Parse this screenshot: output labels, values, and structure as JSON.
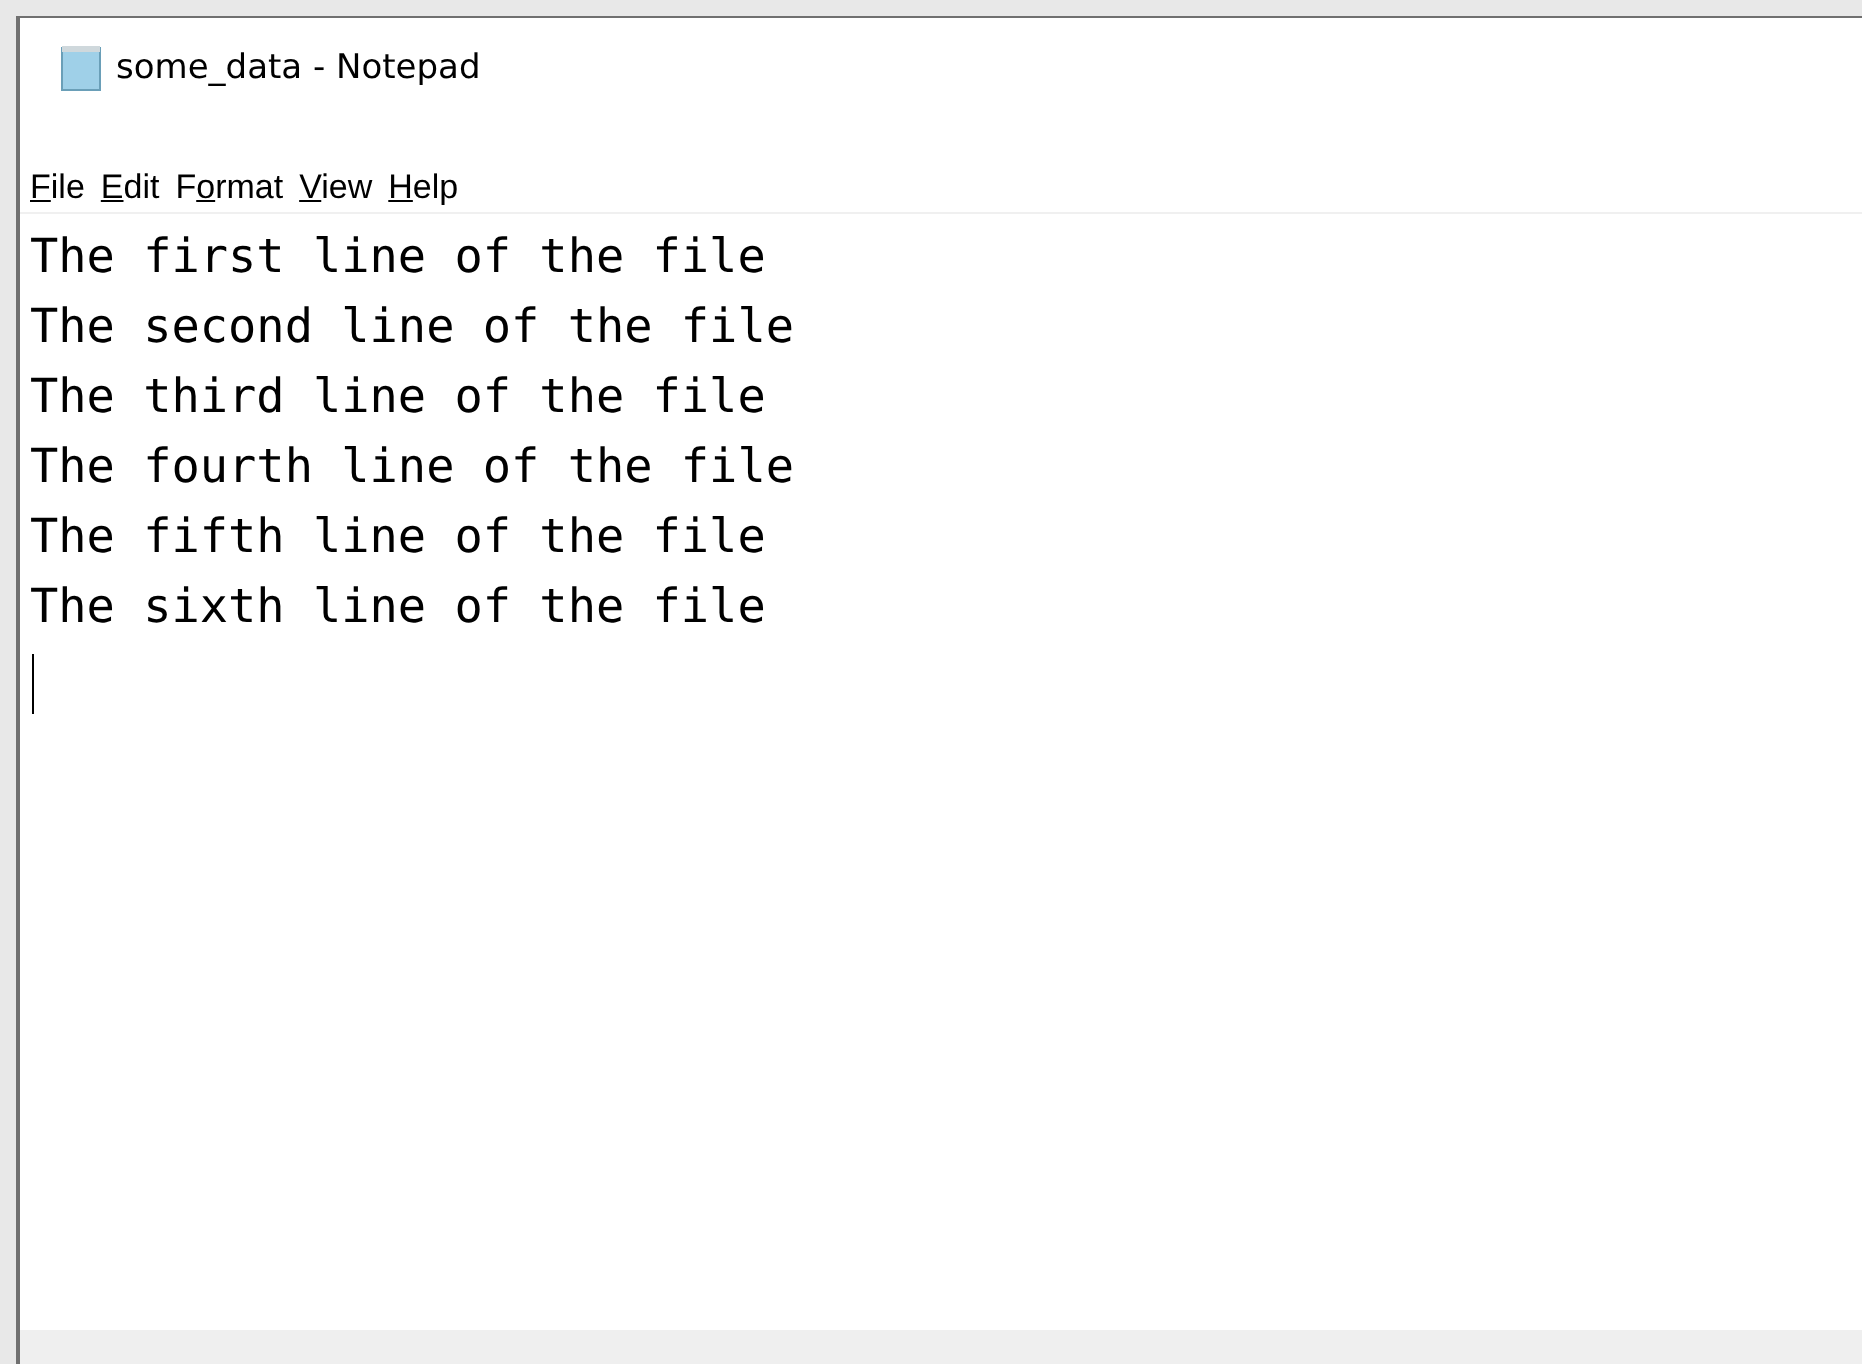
{
  "window": {
    "title": "some_data - Notepad"
  },
  "menu": [
    {
      "key": "F",
      "post": "ile"
    },
    {
      "key": "E",
      "post": "dit"
    },
    {
      "pre": "F",
      "key": "o",
      "post": "rmat"
    },
    {
      "key": "V",
      "post": "iew"
    },
    {
      "key": "H",
      "post": "elp"
    }
  ],
  "lines": [
    "The first line of the file",
    "The second line of the file",
    "The third line of the file",
    "The fourth line of the file",
    "The fifth line of the file",
    "The sixth line of the file"
  ],
  "caret": {
    "on": true
  }
}
